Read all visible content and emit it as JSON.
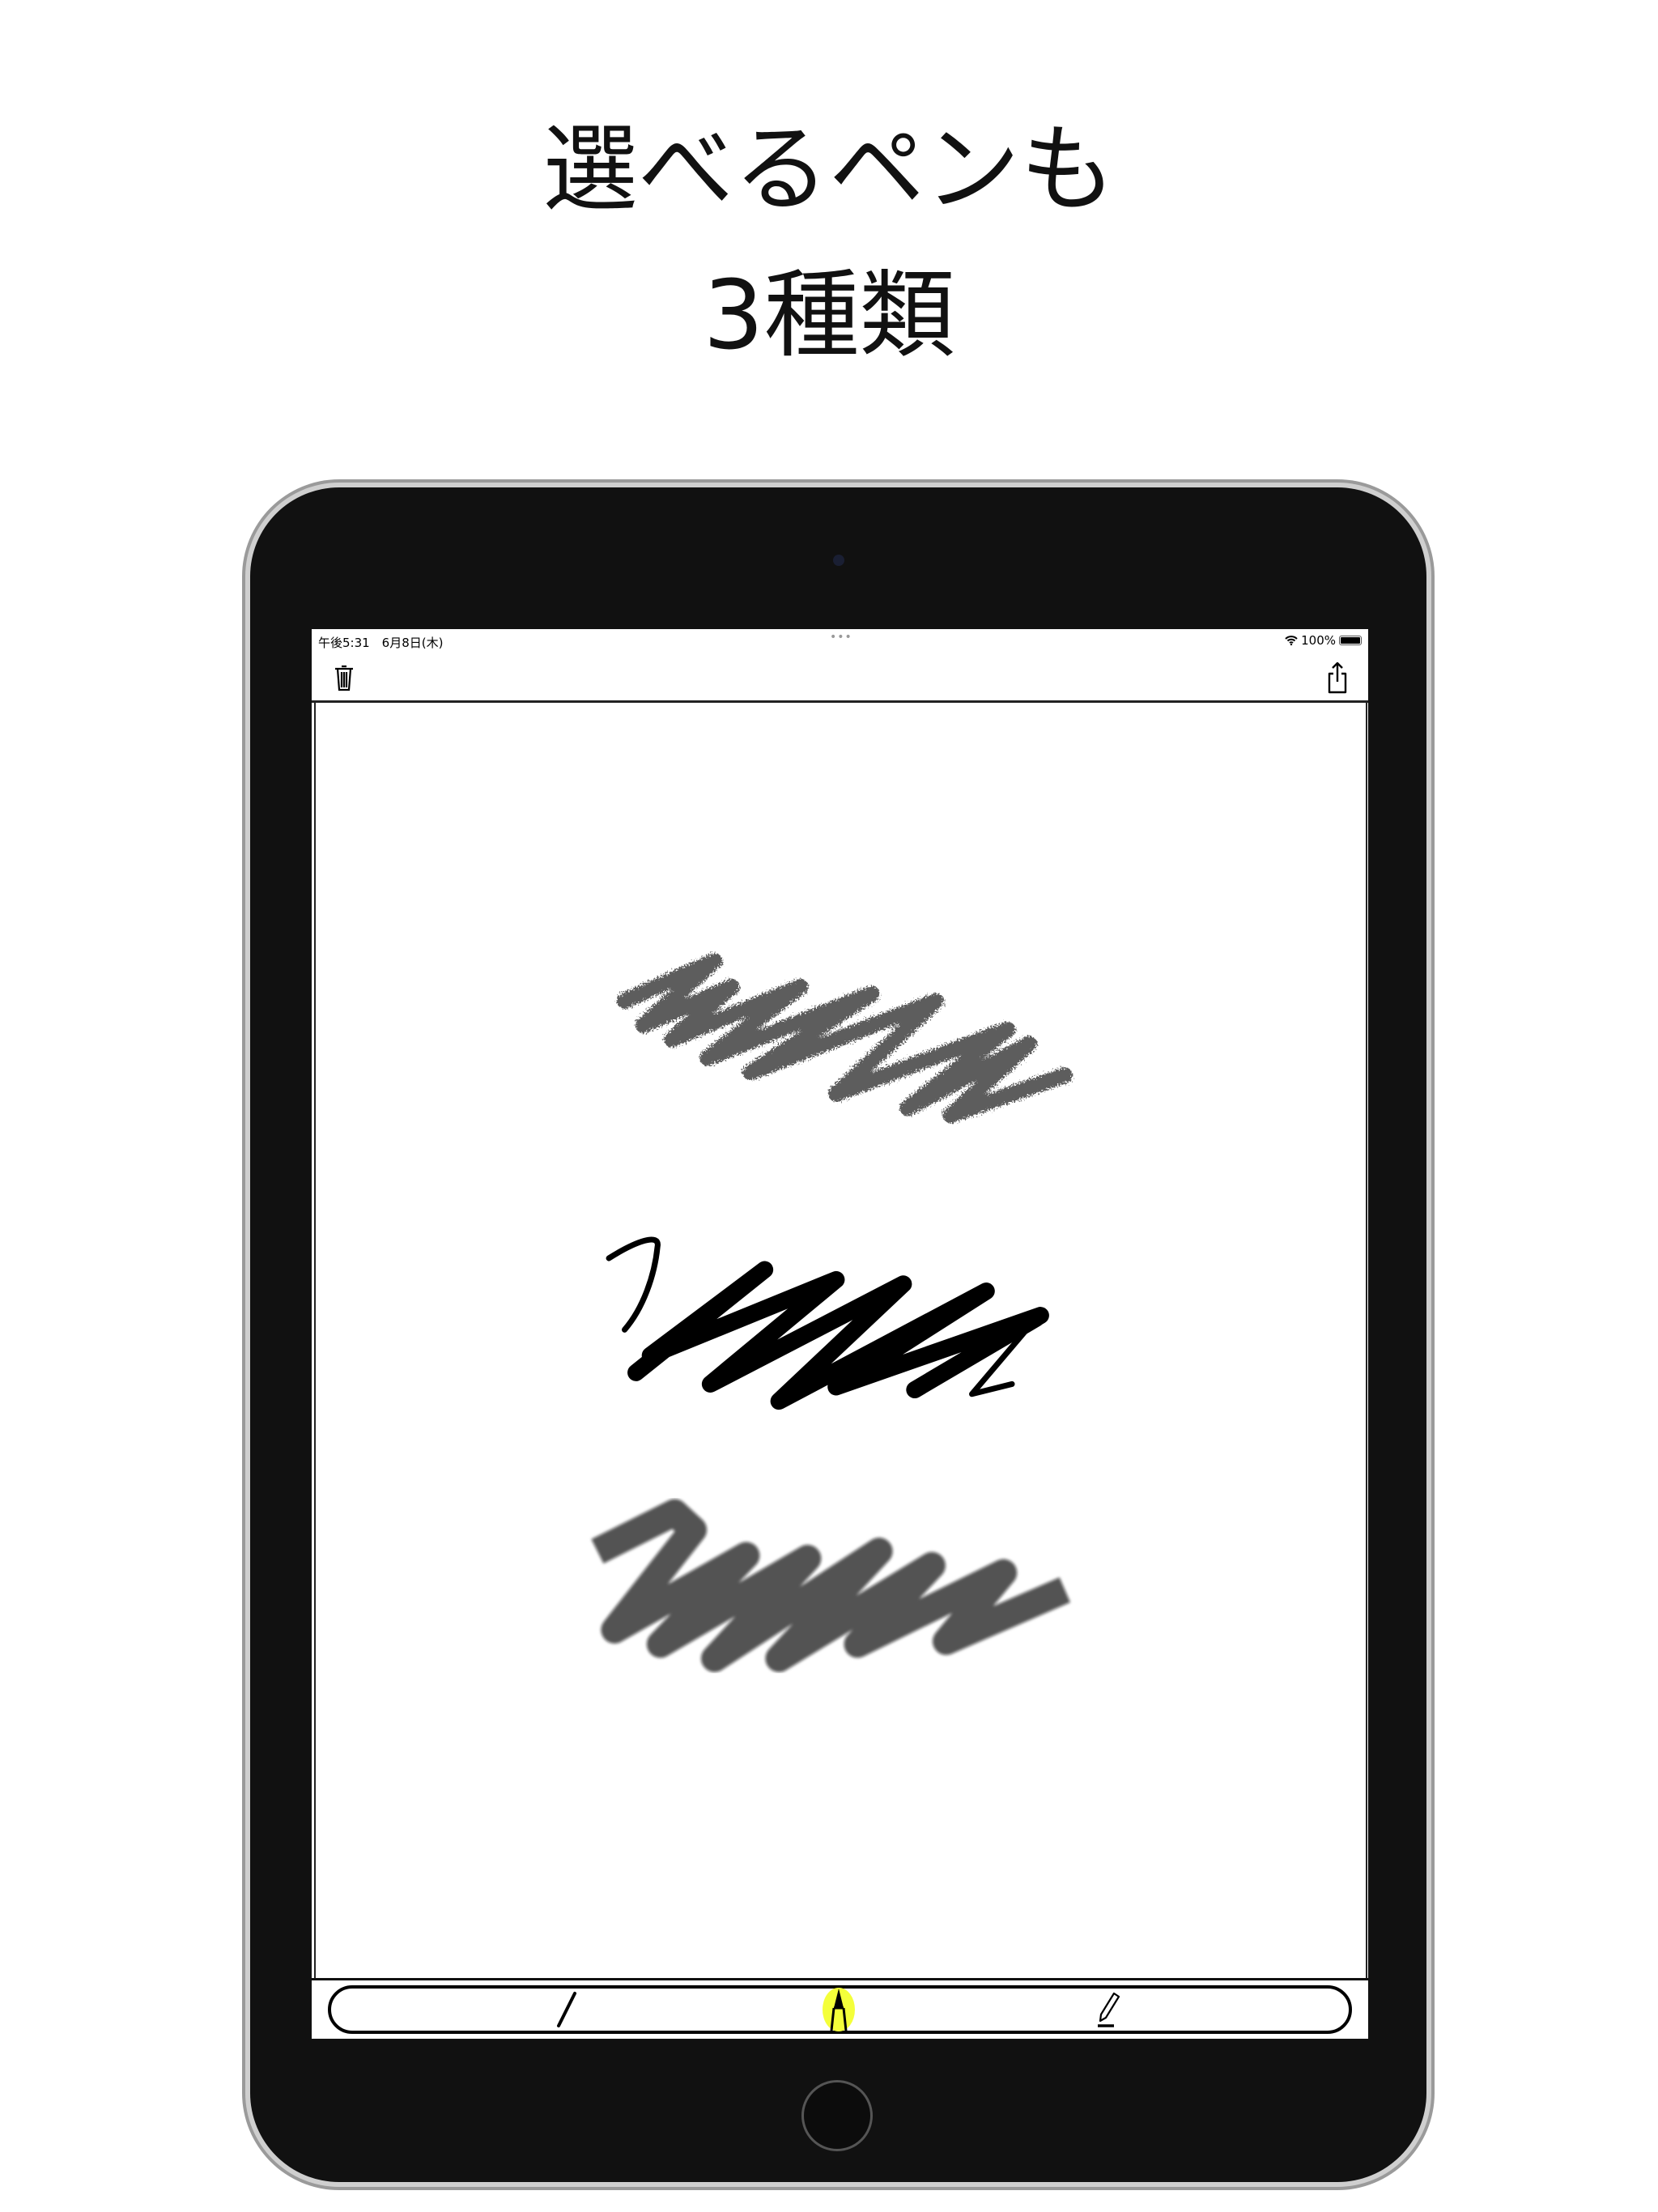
{
  "headline": {
    "line1": "選べるペンも",
    "line2": "3種類"
  },
  "status_bar": {
    "time_date": "午後5:31　6月8日(木)",
    "dots": "•••",
    "battery": "100%"
  },
  "navbar": {
    "left_icon": "trash-icon",
    "right_icon": "share-icon"
  },
  "canvas": {
    "strokes": [
      "pencil",
      "pen",
      "marker"
    ]
  },
  "toolbar": {
    "tools": [
      {
        "name": "pen",
        "icon": "pen-icon",
        "selected": false
      },
      {
        "name": "marker",
        "icon": "marker-icon",
        "selected": true
      },
      {
        "name": "pencil",
        "icon": "pencil-icon",
        "selected": false
      }
    ],
    "selected_color": "#f4ff3a"
  }
}
